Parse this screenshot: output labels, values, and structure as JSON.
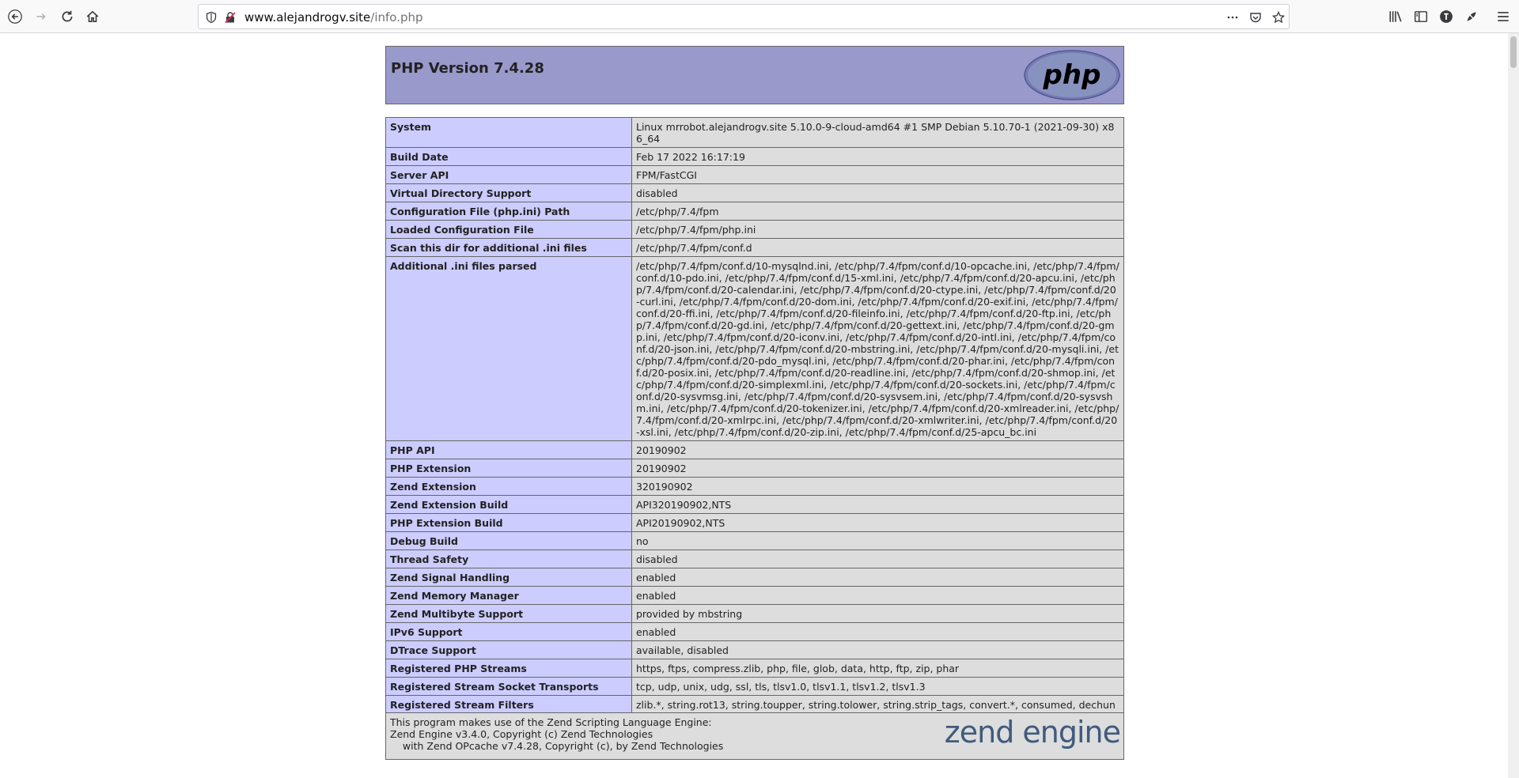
{
  "browser": {
    "url_host": "www.alejandrogv.site",
    "url_path": "/info.php"
  },
  "page": {
    "title": "PHP Version 7.4.28",
    "logo_text": "php"
  },
  "rows": [
    {
      "k": "System",
      "v": "Linux mrrobot.alejandrogv.site 5.10.0-9-cloud-amd64 #1 SMP Debian 5.10.70-1 (2021-09-30) x86_64"
    },
    {
      "k": "Build Date",
      "v": "Feb 17 2022 16:17:19"
    },
    {
      "k": "Server API",
      "v": "FPM/FastCGI"
    },
    {
      "k": "Virtual Directory Support",
      "v": "disabled"
    },
    {
      "k": "Configuration File (php.ini) Path",
      "v": "/etc/php/7.4/fpm"
    },
    {
      "k": "Loaded Configuration File",
      "v": "/etc/php/7.4/fpm/php.ini"
    },
    {
      "k": "Scan this dir for additional .ini files",
      "v": "/etc/php/7.4/fpm/conf.d"
    },
    {
      "k": "Additional .ini files parsed",
      "v": "/etc/php/7.4/fpm/conf.d/10-mysqlnd.ini, /etc/php/7.4/fpm/conf.d/10-opcache.ini, /etc/php/7.4/fpm/conf.d/10-pdo.ini, /etc/php/7.4/fpm/conf.d/15-xml.ini, /etc/php/7.4/fpm/conf.d/20-apcu.ini, /etc/php/7.4/fpm/conf.d/20-calendar.ini, /etc/php/7.4/fpm/conf.d/20-ctype.ini, /etc/php/7.4/fpm/conf.d/20-curl.ini, /etc/php/7.4/fpm/conf.d/20-dom.ini, /etc/php/7.4/fpm/conf.d/20-exif.ini, /etc/php/7.4/fpm/conf.d/20-ffi.ini, /etc/php/7.4/fpm/conf.d/20-fileinfo.ini, /etc/php/7.4/fpm/conf.d/20-ftp.ini, /etc/php/7.4/fpm/conf.d/20-gd.ini, /etc/php/7.4/fpm/conf.d/20-gettext.ini, /etc/php/7.4/fpm/conf.d/20-gmp.ini, /etc/php/7.4/fpm/conf.d/20-iconv.ini, /etc/php/7.4/fpm/conf.d/20-intl.ini, /etc/php/7.4/fpm/conf.d/20-json.ini, /etc/php/7.4/fpm/conf.d/20-mbstring.ini, /etc/php/7.4/fpm/conf.d/20-mysqli.ini, /etc/php/7.4/fpm/conf.d/20-pdo_mysql.ini, /etc/php/7.4/fpm/conf.d/20-phar.ini, /etc/php/7.4/fpm/conf.d/20-posix.ini, /etc/php/7.4/fpm/conf.d/20-readline.ini, /etc/php/7.4/fpm/conf.d/20-shmop.ini, /etc/php/7.4/fpm/conf.d/20-simplexml.ini, /etc/php/7.4/fpm/conf.d/20-sockets.ini, /etc/php/7.4/fpm/conf.d/20-sysvmsg.ini, /etc/php/7.4/fpm/conf.d/20-sysvsem.ini, /etc/php/7.4/fpm/conf.d/20-sysvshm.ini, /etc/php/7.4/fpm/conf.d/20-tokenizer.ini, /etc/php/7.4/fpm/conf.d/20-xmlreader.ini, /etc/php/7.4/fpm/conf.d/20-xmlrpc.ini, /etc/php/7.4/fpm/conf.d/20-xmlwriter.ini, /etc/php/7.4/fpm/conf.d/20-xsl.ini, /etc/php/7.4/fpm/conf.d/20-zip.ini, /etc/php/7.4/fpm/conf.d/25-apcu_bc.ini"
    },
    {
      "k": "PHP API",
      "v": "20190902"
    },
    {
      "k": "PHP Extension",
      "v": "20190902"
    },
    {
      "k": "Zend Extension",
      "v": "320190902"
    },
    {
      "k": "Zend Extension Build",
      "v": "API320190902,NTS"
    },
    {
      "k": "PHP Extension Build",
      "v": "API20190902,NTS"
    },
    {
      "k": "Debug Build",
      "v": "no"
    },
    {
      "k": "Thread Safety",
      "v": "disabled"
    },
    {
      "k": "Zend Signal Handling",
      "v": "enabled"
    },
    {
      "k": "Zend Memory Manager",
      "v": "enabled"
    },
    {
      "k": "Zend Multibyte Support",
      "v": "provided by mbstring"
    },
    {
      "k": "IPv6 Support",
      "v": "enabled"
    },
    {
      "k": "DTrace Support",
      "v": "available, disabled"
    },
    {
      "k": "Registered PHP Streams",
      "v": "https, ftps, compress.zlib, php, file, glob, data, http, ftp, zip, phar"
    },
    {
      "k": "Registered Stream Socket Transports",
      "v": "tcp, udp, unix, udg, ssl, tls, tlsv1.0, tlsv1.1, tlsv1.2, tlsv1.3"
    },
    {
      "k": "Registered Stream Filters",
      "v": "zlib.*, string.rot13, string.toupper, string.tolower, string.strip_tags, convert.*, consumed, dechunk, convert.iconv.*"
    }
  ],
  "zend": {
    "line1": "This program makes use of the Zend Scripting Language Engine:",
    "line2": "Zend Engine v3.4.0, Copyright (c) Zend Technologies",
    "line3": "    with Zend OPcache v7.4.28, Copyright (c), by Zend Technologies",
    "logo_text": "zend engine"
  }
}
